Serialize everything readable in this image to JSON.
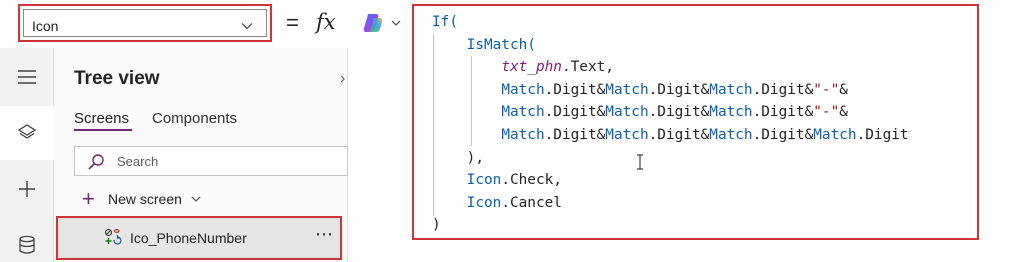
{
  "formula_bar": {
    "property_value": "Icon",
    "equals": "=",
    "fx": "fx"
  },
  "rail": {
    "items": [
      "hamburger-icon",
      "layers-icon",
      "plus-icon",
      "database-icon"
    ],
    "active": "layers-icon"
  },
  "tree_view": {
    "title": "Tree view",
    "close": "›",
    "tabs": [
      {
        "label": "Screens",
        "selected": true
      },
      {
        "label": "Components",
        "selected": false
      }
    ],
    "search_placeholder": "Search",
    "new_screen_label": "New screen",
    "items": [
      {
        "label": "Ico_PhoneNumber",
        "selected": true
      }
    ],
    "more": "⋯"
  },
  "formula": {
    "lines": [
      [
        {
          "t": "If(",
          "c": "kw"
        }
      ],
      [
        {
          "t": "    IsMatch(",
          "c": "fn"
        }
      ],
      [
        {
          "t": "        ",
          "c": "plain"
        },
        {
          "t": "txt_phn",
          "c": "var"
        },
        {
          "t": ".Text,",
          "c": "plain"
        }
      ],
      [
        {
          "t": "        ",
          "c": "plain"
        },
        {
          "t": "Match",
          "c": "fn"
        },
        {
          "t": ".Digit&",
          "c": "plain"
        },
        {
          "t": "Match",
          "c": "fn"
        },
        {
          "t": ".Digit&",
          "c": "plain"
        },
        {
          "t": "Match",
          "c": "fn"
        },
        {
          "t": ".Digit&",
          "c": "plain"
        },
        {
          "t": "\"-\"",
          "c": "str"
        },
        {
          "t": "&",
          "c": "plain"
        }
      ],
      [
        {
          "t": "        ",
          "c": "plain"
        },
        {
          "t": "Match",
          "c": "fn"
        },
        {
          "t": ".Digit&",
          "c": "plain"
        },
        {
          "t": "Match",
          "c": "fn"
        },
        {
          "t": ".Digit&",
          "c": "plain"
        },
        {
          "t": "Match",
          "c": "fn"
        },
        {
          "t": ".Digit&",
          "c": "plain"
        },
        {
          "t": "\"-\"",
          "c": "str"
        },
        {
          "t": "&",
          "c": "plain"
        }
      ],
      [
        {
          "t": "        ",
          "c": "plain"
        },
        {
          "t": "Match",
          "c": "fn"
        },
        {
          "t": ".Digit&",
          "c": "plain"
        },
        {
          "t": "Match",
          "c": "fn"
        },
        {
          "t": ".Digit&",
          "c": "plain"
        },
        {
          "t": "Match",
          "c": "fn"
        },
        {
          "t": ".Digit&",
          "c": "plain"
        },
        {
          "t": "Match",
          "c": "fn"
        },
        {
          "t": ".Digit",
          "c": "plain"
        }
      ],
      [
        {
          "t": "    ),",
          "c": "plain"
        }
      ],
      [
        {
          "t": "    ",
          "c": "plain"
        },
        {
          "t": "Icon",
          "c": "fn"
        },
        {
          "t": ".Check,",
          "c": "plain"
        }
      ],
      [
        {
          "t": "    ",
          "c": "plain"
        },
        {
          "t": "Icon",
          "c": "fn"
        },
        {
          "t": ".Cancel",
          "c": "plain"
        }
      ],
      [
        {
          "t": ")",
          "c": "plain"
        }
      ]
    ]
  },
  "colors": {
    "highlight_border": "#d13438",
    "accent": "#742774",
    "keyword": "#0f5fa8",
    "string": "#a31515"
  }
}
